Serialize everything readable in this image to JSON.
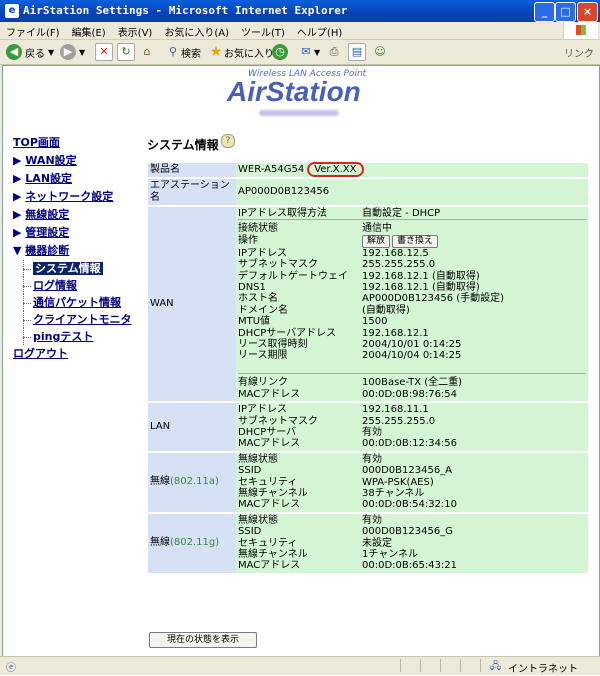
{
  "window": {
    "title": "AirStation Settings - Microsoft Internet Explorer",
    "controls": {
      "minimize": "_",
      "maximize": "□",
      "close": "×"
    }
  },
  "menu": [
    "ファイル(F)",
    "編集(E)",
    "表示(V)",
    "お気に入り(A)",
    "ツール(T)",
    "ヘルプ(H)"
  ],
  "toolbar": {
    "back": "戻る",
    "search": "検索",
    "favorites": "お気に入り",
    "links": "リンク"
  },
  "brand": {
    "tagline": "Wireless LAN Access Point",
    "name": "AirStation",
    "accent": "#4A5FB8"
  },
  "nav": {
    "items": [
      {
        "label": "TOP画面",
        "prefix": ""
      },
      {
        "label": "WAN設定",
        "prefix": "▶ "
      },
      {
        "label": "LAN設定",
        "prefix": "▶ "
      },
      {
        "label": "ネットワーク設定",
        "prefix": "▶ "
      },
      {
        "label": "無線設定",
        "prefix": "▶ "
      },
      {
        "label": "管理設定",
        "prefix": "▶ "
      },
      {
        "label": "機器診断",
        "prefix": "▼ "
      }
    ],
    "subitems": [
      {
        "label": "システム情報",
        "selected": true
      },
      {
        "label": "ログ情報",
        "selected": false
      },
      {
        "label": "通信パケット情報",
        "selected": false
      },
      {
        "label": "クライアントモニタ",
        "selected": false
      },
      {
        "label": "pingテスト",
        "selected": false
      }
    ],
    "logout": "ログアウト"
  },
  "page": {
    "title": "システム情報"
  },
  "product": {
    "label": "製品名",
    "model": "WER-A54G54",
    "version": "Ver.X.XX"
  },
  "airstation_name": {
    "label": "エアステーション名",
    "value": "AP000D0B123456"
  },
  "wan": {
    "label": "WAN",
    "ip_method_label": "IPアドレス取得方法",
    "ip_method_value": "自動設定 - DHCP",
    "status_label": "接続状態",
    "status_value": "通信中",
    "operation_label": "操作",
    "release_button": "解放",
    "renew_button": "書き換え",
    "rows": [
      {
        "k": "IPアドレス",
        "v": "192.168.12.5"
      },
      {
        "k": "サブネットマスク",
        "v": "255.255.255.0"
      },
      {
        "k": "デフォルトゲートウェイ",
        "v": "192.168.12.1 (自動取得)"
      },
      {
        "k": "DNS1",
        "v": "192.168.12.1 (自動取得)"
      },
      {
        "k": "ホスト名",
        "v": "AP000D0B123456 (手動設定)"
      },
      {
        "k": "ドメイン名",
        "v": "(自動取得)"
      },
      {
        "k": "MTU値",
        "v": "1500"
      },
      {
        "k": "DHCPサーバアドレス",
        "v": "192.168.12.1"
      },
      {
        "k": "リース取得時刻",
        "v": "2004/10/01 0:14:25"
      },
      {
        "k": "リース期限",
        "v": "2004/10/04 0:14:25"
      }
    ],
    "link_rows": [
      {
        "k": "有線リンク",
        "v": "100Base-TX (全二重)"
      },
      {
        "k": "MACアドレス",
        "v": "00:0D:0B:98:76:54"
      }
    ]
  },
  "lan": {
    "label": "LAN",
    "rows": [
      {
        "k": "IPアドレス",
        "v": "192.168.11.1"
      },
      {
        "k": "サブネットマスク",
        "v": "255.255.255.0"
      },
      {
        "k": "DHCPサーバ",
        "v": "有効"
      },
      {
        "k": "MACアドレス",
        "v": "00:0D:0B:12:34:56"
      }
    ]
  },
  "wireless_a": {
    "label": "無線",
    "band": "(802.11a)",
    "rows": [
      {
        "k": "無線状態",
        "v": "有効"
      },
      {
        "k": "SSID",
        "v": "000D0B123456_A"
      },
      {
        "k": "セキュリティ",
        "v": "WPA-PSK(AES)"
      },
      {
        "k": "無線チャンネル",
        "v": "38チャンネル"
      },
      {
        "k": "MACアドレス",
        "v": "00:0D:0B:54:32:10"
      }
    ]
  },
  "wireless_g": {
    "label": "無線",
    "band": "(802.11g)",
    "rows": [
      {
        "k": "無線状態",
        "v": "有効"
      },
      {
        "k": "SSID",
        "v": "000D0B123456_G"
      },
      {
        "k": "セキュリティ",
        "v": "未設定"
      },
      {
        "k": "無線チャンネル",
        "v": "1チャンネル"
      },
      {
        "k": "MACアドレス",
        "v": "00:0D:0B:65:43:21"
      }
    ]
  },
  "show_status_button": "現在の状態を表示",
  "status_bar": {
    "zone": "イントラネット"
  },
  "colors": {
    "label_bg": "#D6E1F6",
    "value_bg": "#D4F5D4",
    "version_highlight": "#D9241C",
    "nav_text": "#000080"
  }
}
